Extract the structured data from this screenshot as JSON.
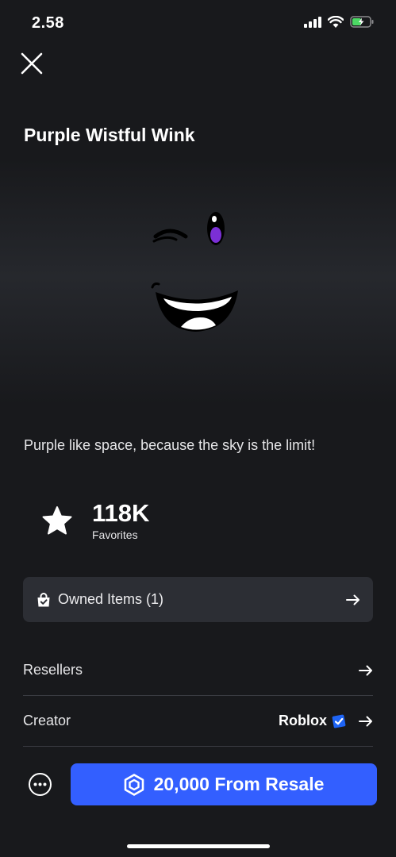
{
  "status_bar": {
    "time": "2.58"
  },
  "item": {
    "title": "Purple Wistful Wink",
    "description": "Purple like space, because the sky is the limit!"
  },
  "favorites": {
    "count": "118K",
    "label": "Favorites"
  },
  "owned_items": {
    "label": "Owned Items (1)"
  },
  "rows": {
    "resellers": {
      "label": "Resellers"
    },
    "creator": {
      "label": "Creator",
      "value": "Roblox"
    }
  },
  "buy_button": {
    "label": "20,000 From Resale"
  },
  "colors": {
    "accent": "#335fff",
    "background": "#18191c",
    "card": "#2c2e34",
    "verified": "#1e64f5",
    "eye_purple": "#7b2fd6"
  },
  "icons": [
    "signal-icon",
    "wifi-icon",
    "battery-icon",
    "close-icon",
    "star-icon",
    "shopping-bag-icon",
    "arrow-right-icon",
    "verified-badge-icon",
    "more-icon",
    "robux-icon"
  ]
}
